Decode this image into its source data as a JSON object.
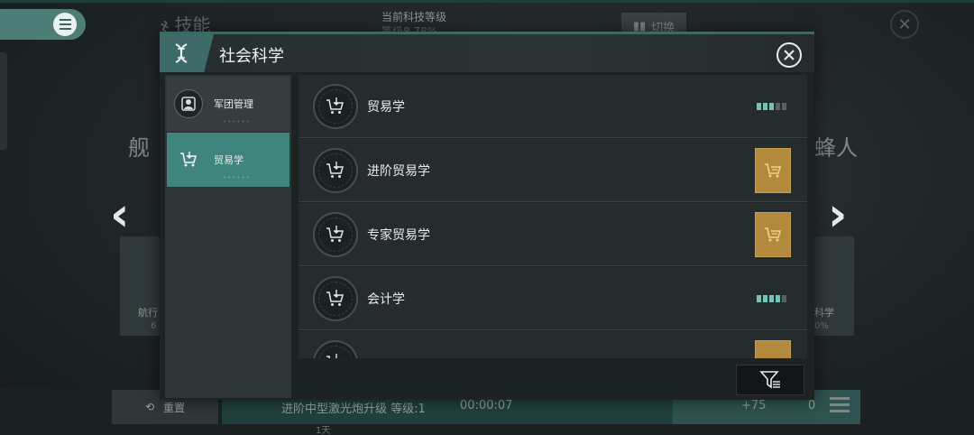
{
  "background": {
    "skill_title": "技能",
    "tech_level_label": "当前科技等级",
    "tech_level_value": "等级8   78%",
    "switch_label": "切换",
    "left_text": "舰",
    "right_text": "蜂人",
    "left_card_title": "航行",
    "left_card_value": "6",
    "right_card_title": "科学",
    "right_card_value": "0%",
    "reset_label": "重置",
    "upgrade_text": "进阶中型激光炮升级 等级:1",
    "upgrade_time": "00:00:07",
    "upgrade_day": "1天",
    "count_value": "+75",
    "second_count": "0"
  },
  "modal": {
    "title": "社会科学",
    "emblem_icon": "dna-icon",
    "close_icon": "close-icon"
  },
  "sidebar": {
    "items": [
      {
        "label": "军团管理",
        "icon": "profile-icon",
        "active": false
      },
      {
        "label": "贸易学",
        "icon": "cart-icon",
        "active": true
      }
    ]
  },
  "skills": [
    {
      "name": "贸易学",
      "icon": "cart-download-icon",
      "status": "level",
      "level": 3,
      "max_level": 5
    },
    {
      "name": "进阶贸易学",
      "icon": "cart-download-icon",
      "status": "buy",
      "button_icon": "cart-icon"
    },
    {
      "name": "专家贸易学",
      "icon": "cart-download-icon",
      "status": "buy",
      "button_icon": "cart-icon"
    },
    {
      "name": "会计学",
      "icon": "cart-download-icon",
      "status": "level",
      "level": 4,
      "max_level": 5
    },
    {
      "name": "",
      "icon": "cart-download-icon",
      "status": "buy",
      "button_icon": "cart-icon"
    }
  ],
  "filter": {
    "icon": "filter-icon"
  },
  "colors": {
    "accent": "#3f857d",
    "level_on": "#6fc4b7",
    "buy_gold": "#b38a3c",
    "panel": "#1d2223"
  }
}
